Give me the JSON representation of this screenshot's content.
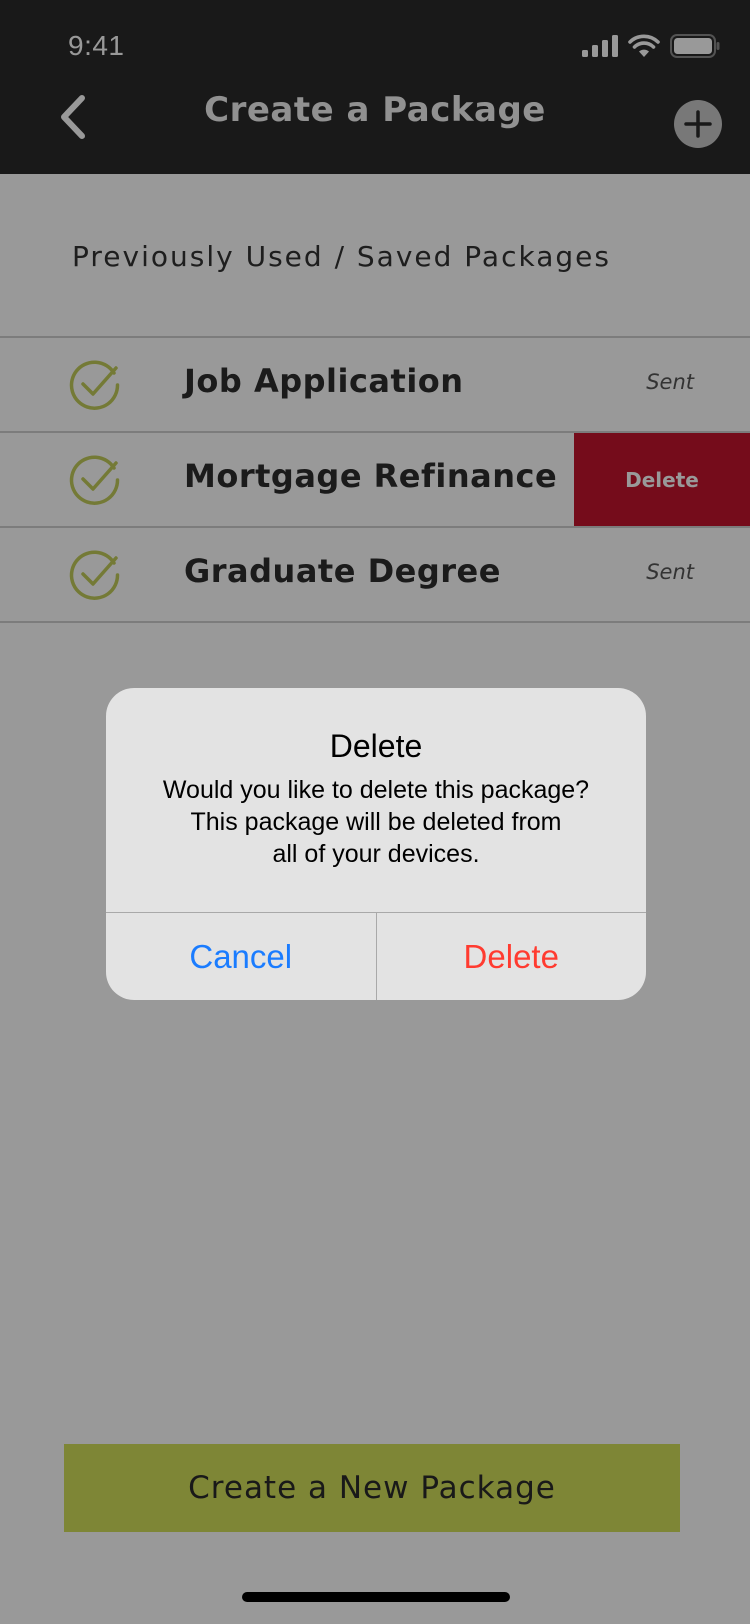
{
  "status_bar": {
    "time": "9:41"
  },
  "nav": {
    "title": "Create a Package",
    "back_icon": "chevron-left-icon",
    "add_icon": "plus-circle-icon"
  },
  "section": {
    "title": "Previously Used / Saved Packages"
  },
  "packages": [
    {
      "name": "Job Application",
      "status": "Sent"
    },
    {
      "name": "Mortgage Refinance",
      "row_action": "Delete"
    },
    {
      "name": "Graduate Degree",
      "status": "Sent"
    }
  ],
  "cta": {
    "label": "Create a New Package"
  },
  "alert": {
    "title": "Delete",
    "message_lines": [
      "Would you like to delete this package?",
      "This package will be deleted from",
      "all of your devices."
    ],
    "cancel_label": "Cancel",
    "confirm_label": "Delete"
  },
  "colors": {
    "nav_background": "#2b2b2b",
    "accent_green": "#d3df5b",
    "check_green": "#c2cc5a",
    "delete_red": "#c4142e",
    "alert_cancel_blue": "#1a7cff",
    "alert_delete_red": "#ff3b30"
  }
}
